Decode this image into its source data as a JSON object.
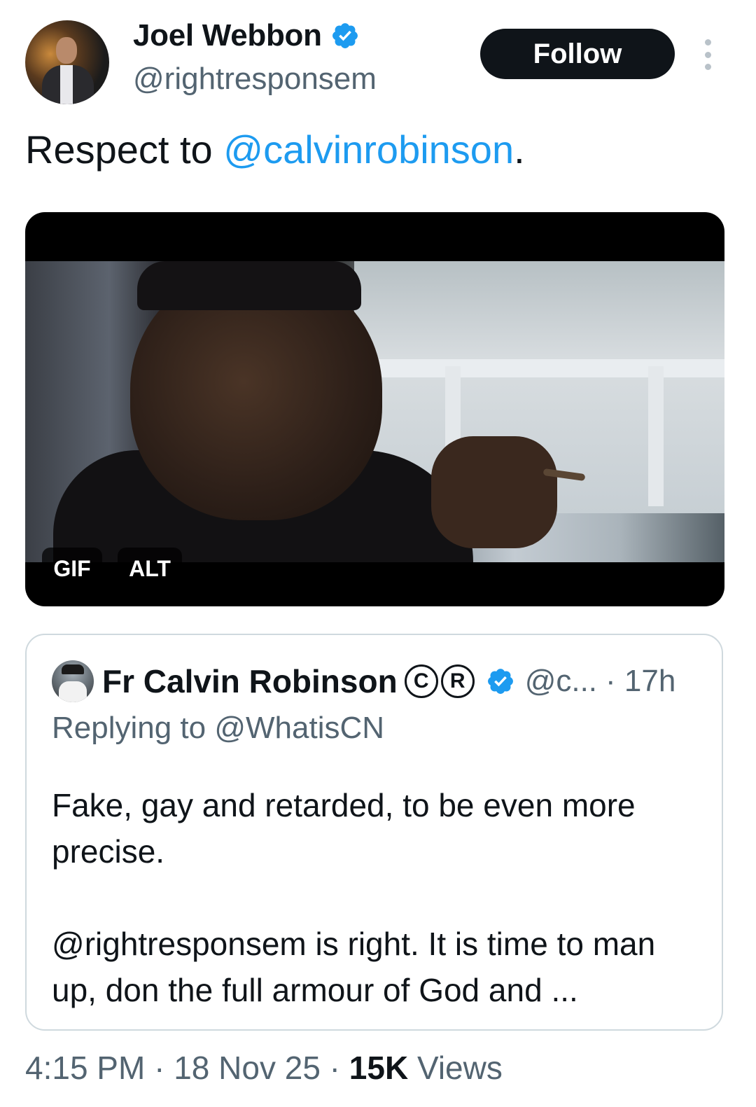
{
  "author": {
    "name": "Joel Webbon",
    "handle": "@rightresponsem",
    "verified": true
  },
  "follow_label": "Follow",
  "tweet": {
    "text_before": "Respect to ",
    "mention": "@calvinrobinson",
    "text_after": "."
  },
  "media": {
    "gif_badge": "GIF",
    "alt_badge": "ALT"
  },
  "quote": {
    "name": "Fr Calvin Robinson",
    "badge_c": "C",
    "badge_r": "R",
    "handle": "@c...",
    "time": "· 17h",
    "replying": "Replying to @WhatisCN",
    "text": "Fake, gay and retarded, to be even more precise.\n\n@rightresponsem is right. It is time to man up, don the full armour of God and ..."
  },
  "meta": {
    "time": "4:15 PM",
    "sep1": " · ",
    "date": "18 Nov 25",
    "sep2": " · ",
    "views_count": "15K",
    "views_label": " Views"
  },
  "colors": {
    "accent": "#1d9bf0",
    "text": "#0f1419",
    "secondary": "#536471"
  },
  "icons": [
    "verified-badge-icon",
    "more-options-icon"
  ]
}
